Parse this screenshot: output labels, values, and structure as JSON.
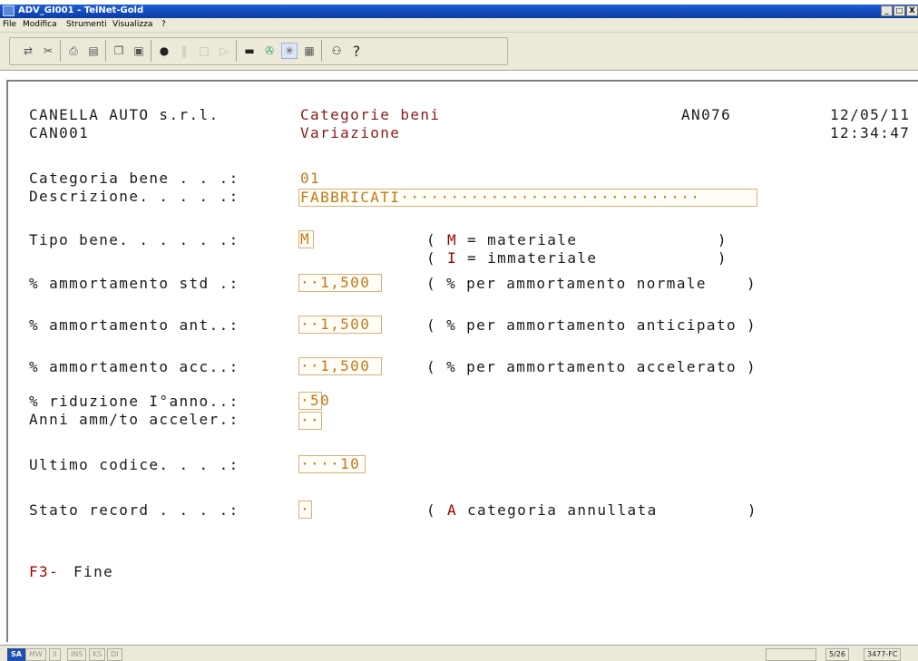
{
  "window": {
    "title": "ADV_GI001 - TelNet-Gold",
    "buttons": [
      "_",
      "□",
      "X"
    ]
  },
  "menu": [
    "File",
    "Modifica",
    "Strumenti",
    "Visualizza",
    "?"
  ],
  "toolbar": {
    "icons": [
      "connect-icon",
      "disconnect-icon",
      "print-icon",
      "properties-icon",
      "copy-icon",
      "paste-icon",
      "record-icon",
      "pause-icon",
      "stop-icon",
      "play-icon",
      "screen-icon",
      "macro-icon",
      "star-icon",
      "keyboard-icon",
      "users-icon",
      "help-icon"
    ],
    "help_glyph": "?"
  },
  "header": {
    "company": "CANELLA AUTO s.r.l.",
    "user": "CAN001",
    "title": "Categorie beni",
    "mode": "Variazione",
    "program": "AN076",
    "date": "12/05/11",
    "time": "12:34:47"
  },
  "form": {
    "categoria_label": "Categoria bene . . .:",
    "categoria_value": "01",
    "descrizione_label": "Descrizione. . . . .:",
    "descrizione_value": "FABBRICATI······························",
    "tipo_label": "Tipo bene. . . . . .:",
    "tipo_value": "M",
    "tipo_hint1_open": "(",
    "tipo_hint1_key": "M",
    "tipo_hint1_text": "= materiale              )",
    "tipo_hint2_open": "(",
    "tipo_hint2_key": "I",
    "tipo_hint2_text": "= immateriale            )",
    "std_label": "% ammortamento std .:",
    "std_value": "··1,500",
    "std_hint": "( % per ammortamento normale    )",
    "ant_label": "% ammortamento ant..:",
    "ant_value": "··1,500",
    "ant_hint": "( % per ammortamento anticipato )",
    "acc_label": "% ammortamento acc..:",
    "acc_value": "··1,500",
    "acc_hint": "( % per ammortamento accelerato )",
    "rid_label": "% riduzione I°anno..:",
    "rid_value": "·50",
    "anni_label": "Anni amm/to acceler.:",
    "anni_value": "··",
    "ultimo_label": "Ultimo codice. . . .:",
    "ultimo_value": "····10",
    "stato_label": "Stato record . . . .:",
    "stato_value": "·",
    "stato_hint_open": "(",
    "stato_hint_key": "A",
    "stato_hint_text": "categoria annullata         )"
  },
  "footer": {
    "fkey": "F3-",
    "fkey_text": "Fine"
  },
  "statusbar": {
    "indicators": [
      "SA",
      "MW",
      "II",
      "INS",
      "KS",
      "DI"
    ],
    "page": "5/26",
    "code": "3477-FC"
  }
}
